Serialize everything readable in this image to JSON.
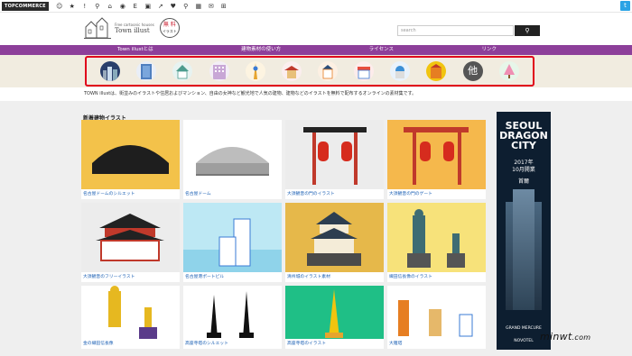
{
  "topbar": {
    "brand": "TOPCOMMERCE",
    "icons": [
      "user-icon",
      "star-icon",
      "alert-icon",
      "pin-icon",
      "home-icon",
      "app-icon",
      "ec-text",
      "lock-icon",
      "share-icon",
      "heart-icon",
      "search-icon",
      "grid-icon",
      "mail-icon",
      "cart-icon"
    ]
  },
  "header": {
    "logo_small": "Free cartoonic houses",
    "logo_name": "Town illust",
    "stamp_line1": "無 料",
    "stamp_line2": "イラスト",
    "search_placeholder": "search",
    "search_button": "🔍"
  },
  "nav": [
    "Town illustとは",
    "建物素材の使い方",
    "ライセンス",
    "リンク"
  ],
  "categories": [
    {
      "name": "city",
      "color": "#2a3f6b"
    },
    {
      "name": "building",
      "color": "#5a8cc4"
    },
    {
      "name": "house",
      "color": "#6fb6a8"
    },
    {
      "name": "apartment",
      "color": "#a77cb6"
    },
    {
      "name": "tower",
      "color": "#e6a42e"
    },
    {
      "name": "temple",
      "color": "#c0392b"
    },
    {
      "name": "castle",
      "color": "#e67e22"
    },
    {
      "name": "shop",
      "color": "#e74c3c"
    },
    {
      "name": "mosque",
      "color": "#3b8fd6"
    },
    {
      "name": "palace",
      "color": "#f1c40f"
    },
    {
      "name": "other",
      "color": "#555555"
    },
    {
      "name": "tree",
      "color": "#ef8fb3"
    }
  ],
  "other_label": "他",
  "intro": "TOWN illustは、街並みのイラストや住居およびマンション、自由の女神など観光地で人気の建物、建物などのイラストを無料で配布するオンラインの素材集です。",
  "section_title": "新着建物イラスト",
  "cards": [
    {
      "caption": "名古屋ドームのシルエット",
      "bg": "#f3c24a"
    },
    {
      "caption": "名古屋ドーム",
      "bg": "#ffffff"
    },
    {
      "caption": "大須観音の門のイラスト",
      "bg": "#ececec"
    },
    {
      "caption": "大須観音の門のゲート",
      "bg": "#f5b84c"
    },
    {
      "caption": "大須観音のフリーイラスト",
      "bg": "#ececec"
    },
    {
      "caption": "名古屋港ポートビル",
      "bg": "#bde8f4"
    },
    {
      "caption": "清州城のイラスト素材",
      "bg": "#e6b84a"
    },
    {
      "caption": "織田信長像のイラスト",
      "bg": "#f7e27a"
    },
    {
      "caption": "金の織田信長像",
      "bg": "#ffffff"
    },
    {
      "caption": "高座寺塔のシルエット",
      "bg": "#ffffff"
    },
    {
      "caption": "高座寺塔のイラスト",
      "bg": "#1fbf86"
    },
    {
      "caption": "大雁塔",
      "bg": "#ffffff"
    }
  ],
  "ad": {
    "title1": "SEOUL",
    "title2": "DRAGON",
    "title3": "CITY",
    "year": "2017年",
    "month": "10月開業",
    "sub": "首爾",
    "hotel1": "GRAND MERCURE",
    "hotel2": "NOVOTEL"
  },
  "watermark": {
    "main": "minwt",
    "suffix": ".com"
  }
}
